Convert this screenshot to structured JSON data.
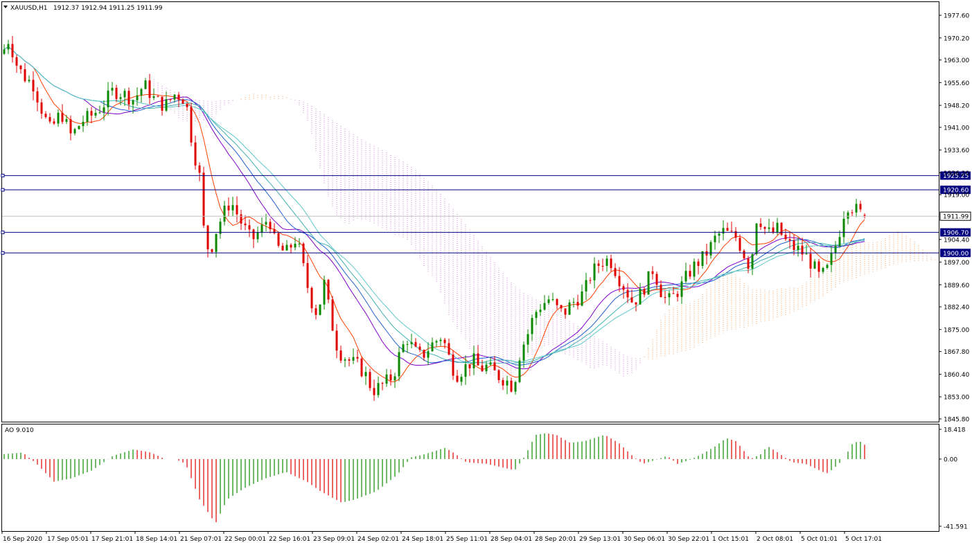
{
  "header": {
    "symbol": "XAUUSD,H1",
    "ohlc": "1912.37 1912.94 1911.25 1911.99"
  },
  "colors": {
    "bull": "#0b8a00",
    "bear": "#e00000",
    "level": "#000080",
    "ma_fast": "#ff4000",
    "ma_purple": "#8000c8",
    "ma_blue": "#2060d0",
    "ma_teal": "#40b0b0",
    "ma_cyan": "#60c8c8",
    "cloud_bull": "#f0a060",
    "cloud_bear": "#d080d0"
  },
  "chart_data": [
    {
      "type": "candlestick",
      "symbol": "XAUUSD",
      "timeframe": "H1",
      "ylim": [
        1845.8,
        1981.0
      ],
      "y_ticks": [
        "1977.60",
        "1970.20",
        "1963.00",
        "1955.60",
        "1948.20",
        "1941.00",
        "1933.60",
        "1926.20",
        "1919.00",
        "1911.99",
        "1904.40",
        "1897.00",
        "1889.60",
        "1882.40",
        "1875.00",
        "1867.80",
        "1860.40",
        "1853.00",
        "1845.80"
      ],
      "x_ticks": [
        "16 Sep 2020",
        "17 Sep 05:01",
        "17 Sep 21:01",
        "18 Sep 14:01",
        "21 Sep 07:01",
        "22 Sep 00:01",
        "22 Sep 16:01",
        "23 Sep 09:01",
        "24 Sep 02:01",
        "24 Sep 18:01",
        "25 Sep 11:01",
        "28 Sep 04:01",
        "28 Sep 20:01",
        "29 Sep 13:01",
        "30 Sep 06:01",
        "30 Sep 22:01",
        "1 Oct 15:01",
        "2 Oct 08:01",
        "5 Oct 01:01",
        "5 Oct 17:01"
      ],
      "current_price": "1911.99",
      "last_bar": {
        "open": 1912.37,
        "high": 1912.94,
        "low": 1911.25,
        "close": 1911.99
      },
      "horizontal_levels": [
        "1925.25",
        "1920.60",
        "1906.70",
        "1900.00"
      ],
      "price_path": [
        [
          0,
          1965
        ],
        [
          10,
          1970
        ],
        [
          20,
          1962
        ],
        [
          30,
          1958
        ],
        [
          45,
          1955
        ],
        [
          60,
          1945
        ],
        [
          70,
          1940
        ],
        [
          85,
          1946
        ],
        [
          100,
          1938
        ],
        [
          115,
          1943
        ],
        [
          130,
          1945
        ],
        [
          145,
          1948
        ],
        [
          160,
          1953
        ],
        [
          175,
          1952
        ],
        [
          190,
          1950
        ],
        [
          205,
          1955
        ],
        [
          220,
          1950
        ],
        [
          235,
          1948
        ],
        [
          250,
          1952
        ],
        [
          265,
          1950
        ],
        [
          275,
          1935
        ],
        [
          285,
          1925
        ],
        [
          292,
          1905
        ],
        [
          300,
          1900
        ],
        [
          310,
          1908
        ],
        [
          320,
          1913
        ],
        [
          330,
          1917
        ],
        [
          345,
          1910
        ],
        [
          360,
          1904
        ],
        [
          375,
          1908
        ],
        [
          385,
          1912
        ],
        [
          395,
          1902
        ],
        [
          410,
          1900
        ],
        [
          425,
          1905
        ],
        [
          435,
          1895
        ],
        [
          445,
          1885
        ],
        [
          455,
          1880
        ],
        [
          465,
          1890
        ],
        [
          475,
          1878
        ],
        [
          485,
          1868
        ],
        [
          500,
          1865
        ],
        [
          515,
          1863
        ],
        [
          525,
          1860
        ],
        [
          535,
          1855
        ],
        [
          550,
          1857
        ],
        [
          565,
          1860
        ],
        [
          575,
          1868
        ],
        [
          585,
          1872
        ],
        [
          595,
          1868
        ],
        [
          605,
          1866
        ],
        [
          620,
          1870
        ],
        [
          635,
          1873
        ],
        [
          645,
          1866
        ],
        [
          655,
          1860
        ],
        [
          665,
          1862
        ],
        [
          680,
          1865
        ],
        [
          690,
          1862
        ],
        [
          700,
          1863
        ],
        [
          715,
          1860
        ],
        [
          730,
          1858
        ],
        [
          738,
          1856
        ],
        [
          748,
          1868
        ],
        [
          758,
          1873
        ],
        [
          768,
          1880
        ],
        [
          778,
          1883
        ],
        [
          790,
          1885
        ],
        [
          800,
          1882
        ],
        [
          810,
          1880
        ],
        [
          820,
          1883
        ],
        [
          830,
          1885
        ],
        [
          840,
          1887
        ],
        [
          850,
          1893
        ],
        [
          860,
          1896
        ],
        [
          870,
          1898
        ],
        [
          880,
          1897
        ],
        [
          890,
          1892
        ],
        [
          900,
          1888
        ],
        [
          910,
          1884
        ],
        [
          920,
          1886
        ],
        [
          930,
          1890
        ],
        [
          940,
          1895
        ],
        [
          950,
          1888
        ],
        [
          960,
          1884
        ],
        [
          970,
          1886
        ],
        [
          980,
          1889
        ],
        [
          990,
          1893
        ],
        [
          1000,
          1896
        ],
        [
          1010,
          1898
        ],
        [
          1020,
          1901
        ],
        [
          1030,
          1905
        ],
        [
          1040,
          1907
        ],
        [
          1050,
          1906
        ],
        [
          1060,
          1905
        ],
        [
          1070,
          1900
        ],
        [
          1080,
          1895
        ],
        [
          1090,
          1913
        ],
        [
          1100,
          1908
        ],
        [
          1110,
          1906
        ],
        [
          1120,
          1908
        ],
        [
          1130,
          1904
        ],
        [
          1140,
          1902
        ],
        [
          1150,
          1901
        ],
        [
          1160,
          1899
        ],
        [
          1170,
          1896
        ],
        [
          1180,
          1892
        ],
        [
          1190,
          1894
        ],
        [
          1200,
          1900
        ],
        [
          1210,
          1908
        ],
        [
          1218,
          1916
        ],
        [
          1228,
          1915
        ],
        [
          1238,
          1913
        ],
        [
          1248,
          1912
        ]
      ]
    },
    {
      "type": "bar",
      "title": "AO 9.010",
      "ylim": [
        -41.591,
        18.418
      ],
      "y_ticks": [
        "18.418",
        "0.00",
        "-41.591"
      ],
      "value_path": [
        [
          0,
          3
        ],
        [
          30,
          4
        ],
        [
          50,
          -3
        ],
        [
          75,
          -14
        ],
        [
          100,
          -12
        ],
        [
          130,
          -7
        ],
        [
          160,
          2
        ],
        [
          190,
          6
        ],
        [
          215,
          4
        ],
        [
          235,
          0
        ],
        [
          250,
          0
        ],
        [
          265,
          -3
        ],
        [
          285,
          -25
        ],
        [
          308,
          -40
        ],
        [
          325,
          -25
        ],
        [
          350,
          -18
        ],
        [
          380,
          -12
        ],
        [
          410,
          -8
        ],
        [
          440,
          -14
        ],
        [
          460,
          -20
        ],
        [
          490,
          -27
        ],
        [
          510,
          -25
        ],
        [
          540,
          -20
        ],
        [
          570,
          -10
        ],
        [
          590,
          1
        ],
        [
          610,
          3
        ],
        [
          640,
          7
        ],
        [
          655,
          3
        ],
        [
          670,
          -2
        ],
        [
          700,
          -3
        ],
        [
          720,
          -5
        ],
        [
          740,
          -7
        ],
        [
          755,
          2
        ],
        [
          770,
          15
        ],
        [
          785,
          16
        ],
        [
          800,
          15
        ],
        [
          820,
          10
        ],
        [
          840,
          11
        ],
        [
          870,
          15
        ],
        [
          890,
          10
        ],
        [
          910,
          2
        ],
        [
          925,
          -3
        ],
        [
          940,
          -1
        ],
        [
          960,
          2
        ],
        [
          975,
          -3
        ],
        [
          990,
          -1
        ],
        [
          1010,
          3
        ],
        [
          1030,
          8
        ],
        [
          1045,
          13
        ],
        [
          1060,
          11
        ],
        [
          1080,
          0
        ],
        [
          1095,
          3
        ],
        [
          1105,
          8
        ],
        [
          1120,
          4
        ],
        [
          1140,
          -2
        ],
        [
          1160,
          -3
        ],
        [
          1175,
          -6
        ],
        [
          1190,
          -9
        ],
        [
          1200,
          -6
        ],
        [
          1215,
          0
        ],
        [
          1228,
          10
        ],
        [
          1238,
          11
        ],
        [
          1248,
          8
        ]
      ]
    }
  ]
}
